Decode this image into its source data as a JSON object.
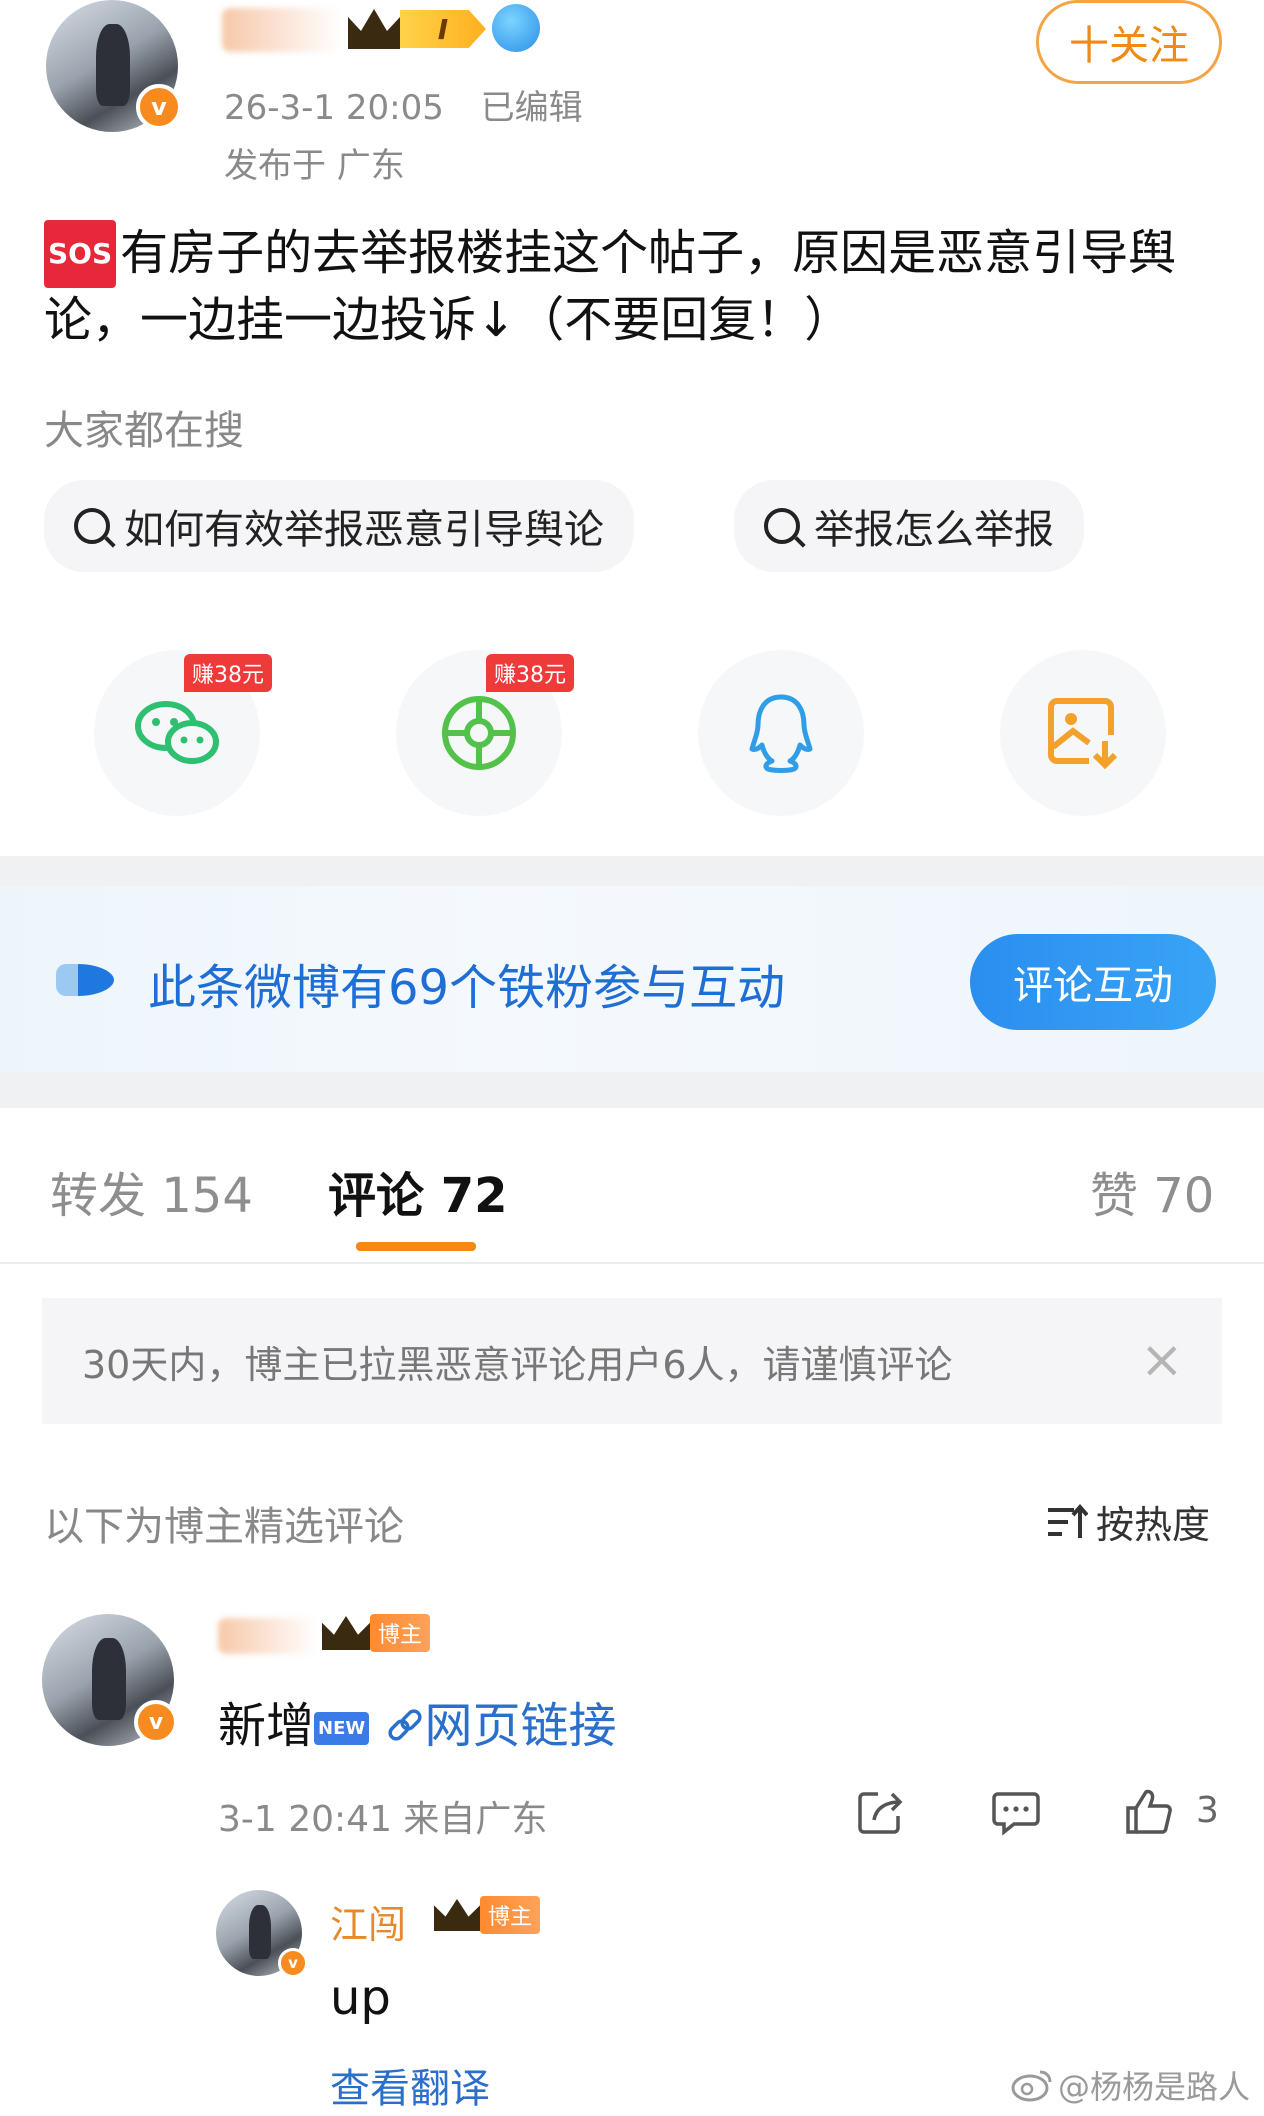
{
  "header": {
    "post_time": "26-3-1 20:05",
    "edited": "已编辑",
    "location": "发布于 广东",
    "level_badge": "I",
    "follow_label": "十关注"
  },
  "post": {
    "sos_label": "SOS",
    "text": "有房子的去举报楼挂这个帖子，原因是恶意引导舆论，一边挂一边投诉↓（不要回复！）"
  },
  "search": {
    "label": "大家都在搜",
    "chips": [
      "如何有效举报恶意引导舆论",
      "举报怎么举报"
    ]
  },
  "share": {
    "items": [
      {
        "icon": "wechat-icon",
        "badge": "赚38元"
      },
      {
        "icon": "moments-icon",
        "badge": "赚38元"
      },
      {
        "icon": "qq-icon",
        "badge": ""
      },
      {
        "icon": "save-image-icon",
        "badge": ""
      }
    ]
  },
  "fans": {
    "text": "此条微博有69个铁粉参与互动",
    "button": "评论互动"
  },
  "tabs": {
    "repost": "转发 154",
    "comment": "评论 72",
    "like": "赞 70"
  },
  "notice": {
    "text": "30天内，博主已拉黑恶意评论用户6人，请谨慎评论",
    "close": "×"
  },
  "comments_header": {
    "label": "以下为博主精选评论",
    "sort": "按热度"
  },
  "comment1": {
    "host_badge": "博主",
    "text_prefix": "新增",
    "new_badge": "NEW",
    "link_text": "网页链接",
    "time_loc": "3-1 20:41 来自广东",
    "likes": "3"
  },
  "reply": {
    "name": "江闯",
    "host_badge": "博主",
    "text": "up",
    "translate": "查看翻译"
  },
  "watermark": "@杨杨是路人",
  "colors": {
    "accent_orange": "#f48a16",
    "link_blue": "#2a6fcb",
    "fan_blue": "#1e6ed6"
  }
}
